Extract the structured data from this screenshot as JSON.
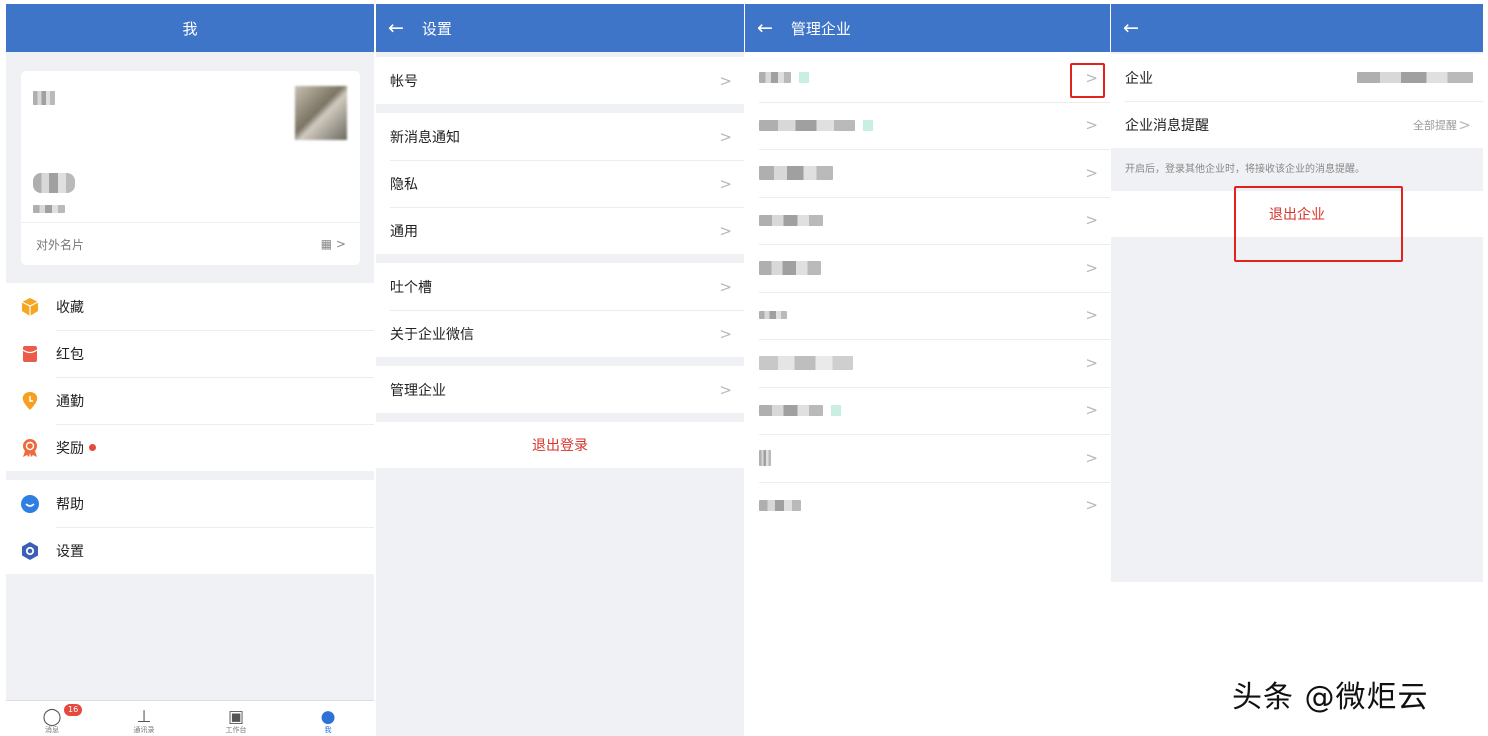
{
  "panel_me": {
    "title": "我",
    "card_footer": "对外名片",
    "qr_glyph": "▦ >",
    "menu": [
      {
        "label": "收藏",
        "icon": "favorites-box-icon",
        "color": "#f5a623"
      },
      {
        "label": "红包",
        "icon": "red-packet-icon",
        "color": "#ec5b49"
      },
      {
        "label": "通勤",
        "icon": "commute-location-icon",
        "color": "#f5a020"
      },
      {
        "label": "奖励",
        "icon": "award-medal-icon",
        "color": "#ef6a3b"
      }
    ],
    "menu2": [
      {
        "label": "帮助",
        "icon": "help-bubble-icon",
        "color": "#2e7ee4"
      },
      {
        "label": "设置",
        "icon": "settings-hexagon-icon",
        "color": "#3b5fb8"
      }
    ],
    "tabs": [
      {
        "label": "消息",
        "icon": "chat-bubble-icon",
        "badge": "16"
      },
      {
        "label": "通讯录",
        "icon": "org-chart-icon"
      },
      {
        "label": "工作台",
        "icon": "grid-apps-icon"
      },
      {
        "label": "我",
        "icon": "person-icon"
      }
    ]
  },
  "panel_settings": {
    "title": "设置",
    "groups": [
      [
        "帐号"
      ],
      [
        "新消息通知",
        "隐私",
        "通用"
      ],
      [
        "吐个槽",
        "关于企业微信"
      ],
      [
        "管理企业"
      ]
    ],
    "logout_label": "退出登录"
  },
  "panel_companies": {
    "title": "管理企业",
    "row_count": 10
  },
  "panel_company": {
    "title": "",
    "row_company_label": "企业",
    "row_notify_label": "企业消息提醒",
    "row_notify_value": "全部提醒",
    "hint": "开启后，登录其他企业时，将接收该企业的消息提醒。",
    "exit_label": "退出企业"
  },
  "watermark": "头条 @微炬云",
  "colors": {
    "header": "#3f75c9",
    "danger": "#d9342b",
    "highlight_box": "#e0241b"
  }
}
